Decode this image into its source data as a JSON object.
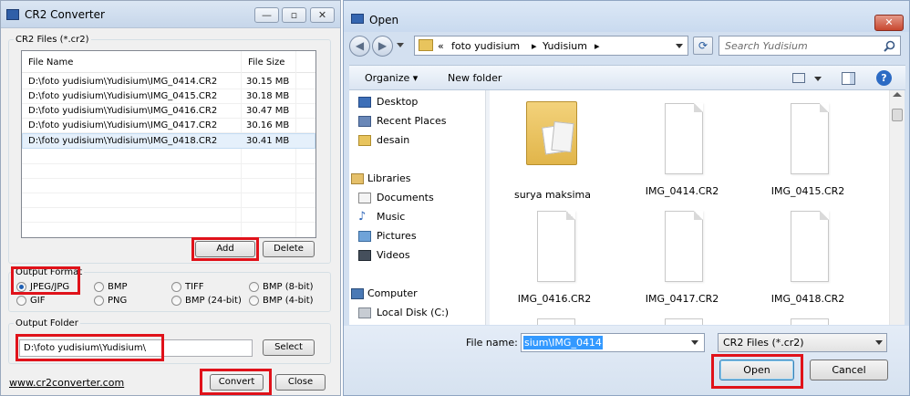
{
  "cr2": {
    "title": "CR2 Converter",
    "caption_min": "—",
    "caption_max": "▫",
    "caption_close": "✕",
    "files_group": "CR2 Files (*.cr2)",
    "columns": [
      "File Name",
      "File Size"
    ],
    "rows": [
      {
        "name": "D:\\foto yudisium\\Yudisium\\IMG_0414.CR2",
        "size": "30.15 MB"
      },
      {
        "name": "D:\\foto yudisium\\Yudisium\\IMG_0415.CR2",
        "size": "30.18 MB"
      },
      {
        "name": "D:\\foto yudisium\\Yudisium\\IMG_0416.CR2",
        "size": "30.47 MB"
      },
      {
        "name": "D:\\foto yudisium\\Yudisium\\IMG_0417.CR2",
        "size": "30.16 MB"
      },
      {
        "name": "D:\\foto yudisium\\Yudisium\\IMG_0418.CR2",
        "size": "30.41 MB"
      }
    ],
    "add_label": "Add",
    "delete_label": "Delete",
    "format_group": "Output Format",
    "formats": [
      "JPEG/JPG",
      "BMP",
      "TIFF",
      "BMP (8-bit)",
      "GIF",
      "PNG",
      "BMP (24-bit)",
      "BMP (4-bit)"
    ],
    "selected_format": "JPEG/JPG",
    "folder_group": "Output Folder",
    "folder_value": "D:\\foto yudisium\\Yudisium\\",
    "select_label": "Select",
    "link": "www.cr2converter.com",
    "convert_label": "Convert",
    "close_label": "Close"
  },
  "open": {
    "title": "Open",
    "close_glyph": "✕",
    "back_glyph": "◀",
    "fwd_glyph": "▶",
    "breadcrumb": [
      "«",
      "foto yudisium",
      "▸",
      "Yudisium",
      "▸"
    ],
    "search_placeholder": "Search Yudisium",
    "organize": "Organize ▾",
    "new_folder": "New folder",
    "nav": {
      "favorites": [
        "Desktop",
        "Recent Places",
        "desain"
      ],
      "libraries_label": "Libraries",
      "libraries": [
        "Documents",
        "Music",
        "Pictures",
        "Videos"
      ],
      "computer_label": "Computer",
      "computer": [
        "Local Disk (C:)"
      ]
    },
    "files": [
      "surya maksima",
      "IMG_0414.CR2",
      "IMG_0415.CR2",
      "IMG_0416.CR2",
      "IMG_0417.CR2",
      "IMG_0418.CR2"
    ],
    "filename_label": "File name:",
    "filename_value": "sium\\IMG_0414",
    "filter_value": "CR2 Files (*.cr2)",
    "open_label": "Open",
    "cancel_label": "Cancel"
  },
  "colors": {
    "highlight": "#e0121a",
    "selection": "#3399ff"
  }
}
